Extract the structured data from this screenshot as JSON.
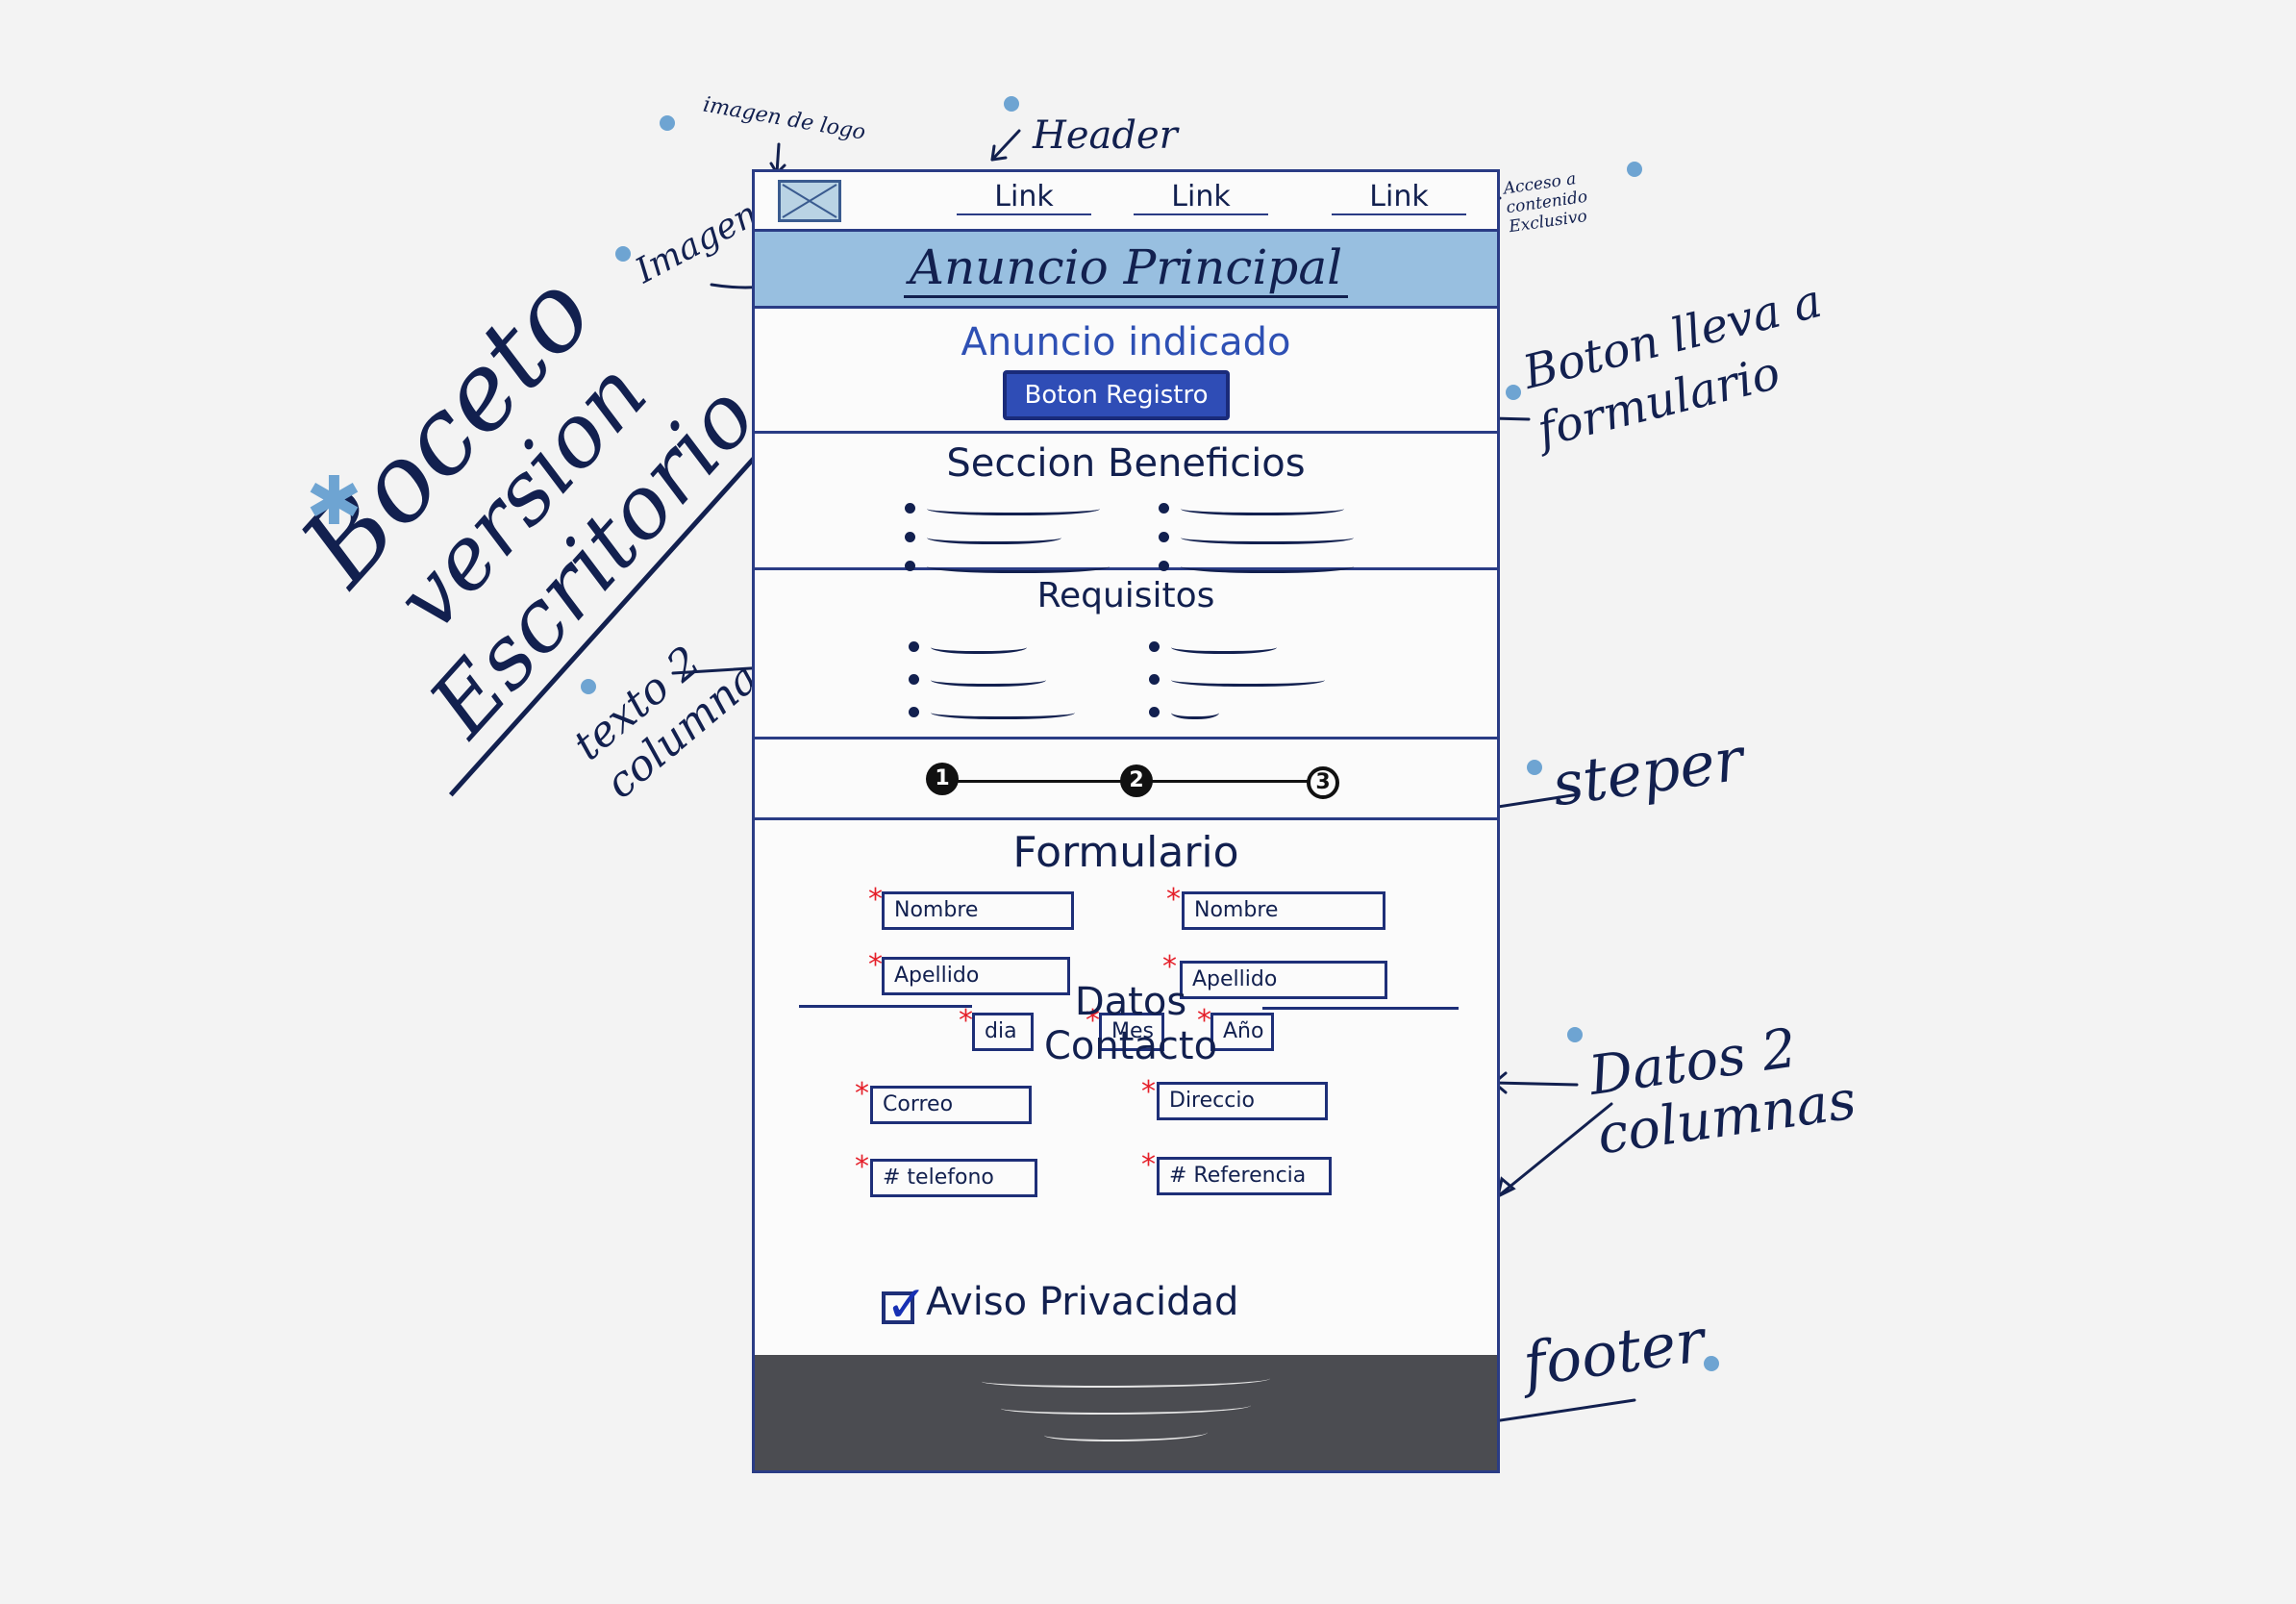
{
  "title": {
    "line1": "Boceto",
    "line2": "version",
    "line3": "Escritorio"
  },
  "annotations": {
    "logo_image": "imagen de logo",
    "header": "Header",
    "image": "Imagen",
    "exclusive_access": "Acceso a contenido Exclusivo",
    "button_note": "Boton lleva a formulario",
    "text_two_columns": "texto 2 columnas",
    "stepper": "steper",
    "data_two_columns": "Datos 2 columnas",
    "footer": "footer"
  },
  "header": {
    "links": [
      "Link",
      "Link",
      "Link"
    ]
  },
  "hero": {
    "title": "Anuncio Principal"
  },
  "cta": {
    "text": "Anuncio indicado",
    "button": "Boton Registro"
  },
  "benefits": {
    "title": "Seccion Beneficios"
  },
  "requirements": {
    "title": "Requisitos"
  },
  "stepper": {
    "steps": [
      "1",
      "2",
      "3"
    ]
  },
  "form": {
    "title": "Formulario",
    "nombre_left": "Nombre",
    "nombre_right": "Nombre",
    "apellido_left": "Apellido",
    "apellido_right": "Apellido",
    "dia": "dia",
    "mes": "Mes",
    "ano": "Año",
    "contact_title": "Datos Contacto",
    "correo": "Correo",
    "direccion": "Direccio",
    "telefono": "# telefono",
    "referencia": "# Referencia",
    "privacy": "Aviso Privacidad",
    "required_mark": "*"
  },
  "colors": {
    "accent": "#2f4db6",
    "hero_bg": "#98bfe0",
    "footer_bg": "#4b4c51",
    "required": "#e5202a",
    "ink": "#12204f"
  }
}
